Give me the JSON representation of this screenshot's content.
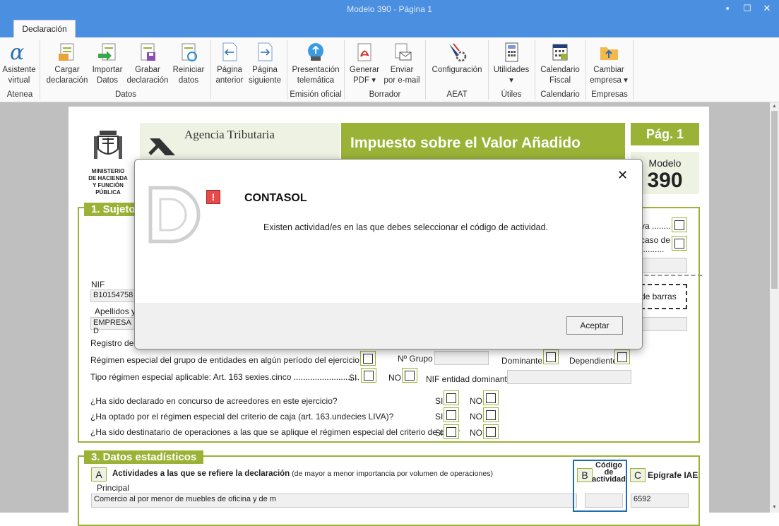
{
  "window": {
    "title": "Modelo 390 - Página 1"
  },
  "tabs": [
    {
      "label": "Declaración"
    }
  ],
  "ribbon": {
    "buttons": [
      {
        "line1": "Asistente",
        "line2": "virtual"
      },
      {
        "line1": "Cargar",
        "line2": "declaración"
      },
      {
        "line1": "Importar",
        "line2": "Datos"
      },
      {
        "line1": "Grabar",
        "line2": "declaración"
      },
      {
        "line1": "Reiniciar",
        "line2": "datos"
      },
      {
        "line1": "Página",
        "line2": "anterior"
      },
      {
        "line1": "Página",
        "line2": "siguiente"
      },
      {
        "line1": "Presentación",
        "line2": "telemática"
      },
      {
        "line1": "Generar",
        "line2": "PDF ▾"
      },
      {
        "line1": "Enviar",
        "line2": "por e-mail"
      },
      {
        "line1": "Configuración",
        "line2": ""
      },
      {
        "line1": "Utilidades",
        "line2": "▾"
      },
      {
        "line1": "Calendario",
        "line2": "Fiscal"
      },
      {
        "line1": "Cambiar",
        "line2": "empresa ▾"
      }
    ],
    "groups": [
      "Atenea",
      "Datos",
      "Emisión oficial",
      "Borrador",
      "AEAT",
      "Útiles",
      "Calendario",
      "Empresas"
    ]
  },
  "doc": {
    "ministry": [
      "MINISTERIO",
      "DE HACIENDA",
      "Y FUNCIÓN PÚBLICA"
    ],
    "agency": "Agencia Tributaria",
    "tax_title": "Impuesto sobre el Valor Añadido",
    "page_label": "Pág. 1",
    "model_label": "Modelo",
    "model_number": "390",
    "section1": "1. Sujeto",
    "right_frag1": "va ........",
    "right_frag2": "caso de",
    "right_frag3": "..........",
    "barcode": "de barras",
    "nif_label": "NIF",
    "nif_value": "B10154758",
    "apellidos_label": "Apellidos y",
    "empresa_value": "EMPRESA D",
    "registro_label": "Registro de e",
    "regimen_grupo": "Régimen especial del grupo de entidades en algún período del ejercicio.......",
    "n_grupo": "Nº Grupo",
    "dominante": "Dominante",
    "dependiente": "Dependiente",
    "tipo_regimen": "Tipo régimen especial aplicable: Art. 163 sexies.cinco ............................",
    "si": "SI",
    "no": "NO",
    "nif_dom": "NIF entidad dominante",
    "q1": "¿Ha sido declarado en concurso de acreedores en este ejercicio?",
    "q2": "¿Ha optado por el régimen especial del criterio de caja (art. 163.undecies LIVA)?",
    "q3": "¿Ha sido destinatario de operaciones a las que se aplique el régimen especial del criterio de caja?",
    "section3": "3. Datos estadísticos",
    "letter_a": "A",
    "act_title": "Actividades a las que se refiere la declaración",
    "act_sub": " (de mayor a menor importancia por volumen de operaciones)",
    "principal": "Principal",
    "letter_b": "B",
    "codigo": [
      "Código",
      "de",
      "actividad"
    ],
    "letter_c": "C",
    "epigrafe": "Epígrafe IAE",
    "activity_value": "Comercio al por menor de muebles de oficina y de m",
    "epigrafe_value": "6592"
  },
  "dialog": {
    "title": "CONTASOL",
    "message": "Existen actividad/es en las que debes seleccionar el código de actividad.",
    "ok": "Aceptar",
    "close": "✕"
  }
}
